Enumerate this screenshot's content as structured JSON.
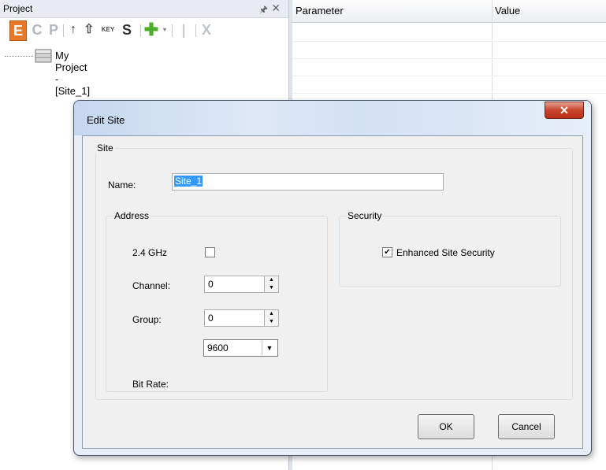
{
  "project_panel": {
    "title": "Project",
    "toolbar": {
      "e": "E",
      "c": "C",
      "p": "P",
      "key": "KEY",
      "s": "S",
      "x": "X"
    },
    "tree": {
      "root_label": "My Project - [Site_1]"
    }
  },
  "property_grid": {
    "col_parameter": "Parameter",
    "col_value": "Value"
  },
  "dialog": {
    "title": "Edit Site",
    "site_group": "Site",
    "name_label": "Name:",
    "name_value": "Site_1",
    "address_group": "Address",
    "ghz_label": "2.4 GHz",
    "ghz_checked": false,
    "channel_label": "Channel:",
    "channel_value": "0",
    "group_label": "Group:",
    "group_value": "0",
    "bitrate_label": "Bit Rate:",
    "bitrate_value": "9600",
    "security_group": "Security",
    "enhanced_security_label": "Enhanced Site Security",
    "enhanced_security_checked": true,
    "ok_label": "OK",
    "cancel_label": "Cancel"
  },
  "colors": {
    "accent_orange": "#e8792a",
    "plus_green": "#4caf2a",
    "dialog_close_red": "#c8452c",
    "selection_blue": "#3399ff"
  }
}
